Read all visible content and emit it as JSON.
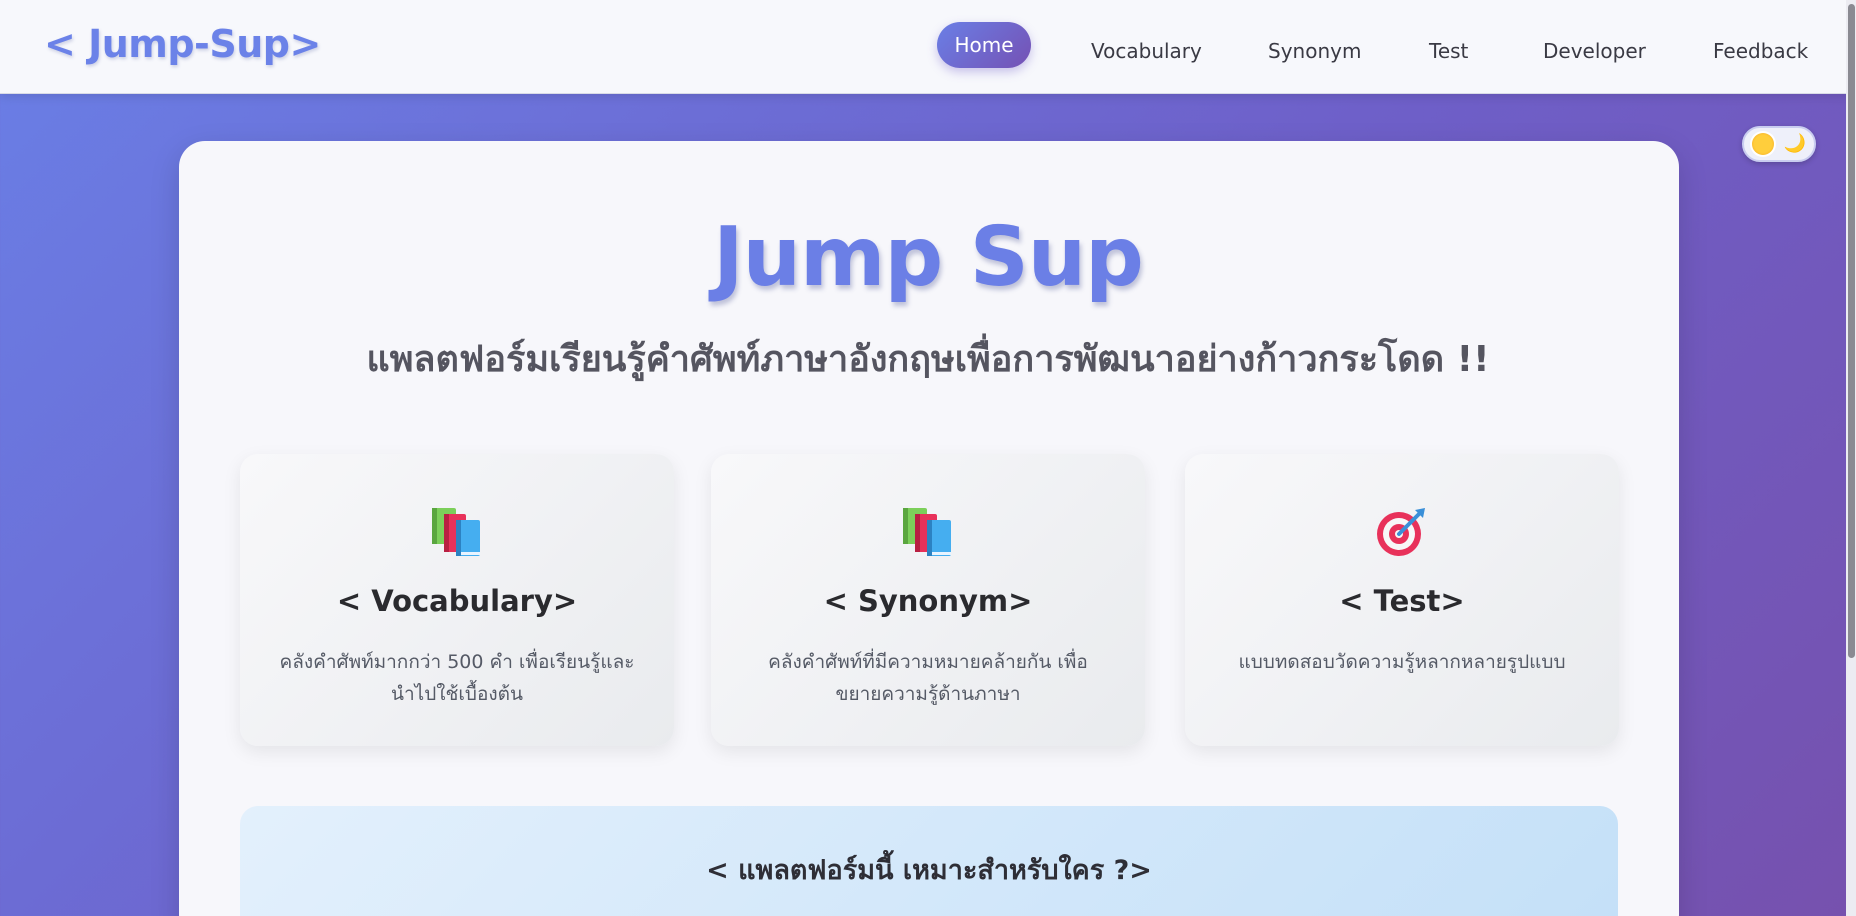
{
  "brand": "< Jump-Sup>",
  "nav": {
    "home": "Home",
    "vocabulary": "Vocabulary",
    "synonym": "Synonym",
    "test": "Test",
    "developer": "Developer",
    "feedback": "Feedback"
  },
  "theme_toggle": {
    "light_icon": "sun-icon",
    "dark_icon": "moon-icon",
    "moon_glyph": "🌙"
  },
  "hero": {
    "title": "Jump Sup",
    "subtitle": "แพลตฟอร์มเรียนรู้คำศัพท์ภาษาอังกฤษเพื่อการพัฒนาอย่างก้าวกระโดด !!"
  },
  "features": [
    {
      "icon": "books-icon",
      "title": "< Vocabulary>",
      "desc": "คลังคำศัพท์มากกว่า 500 คำ เพื่อเรียนรู้และนำไปใช้เบื้องต้น"
    },
    {
      "icon": "books-icon",
      "title": "< Synonym>",
      "desc": "คลังคำศัพท์ที่มีความหมายคล้ายกัน เพื่อขยายความรู้ด้านภาษา"
    },
    {
      "icon": "target-icon",
      "title": "< Test>",
      "desc": "แบบทดสอบวัดความรู้หลากหลายรูปแบบ"
    }
  ],
  "who": {
    "title": "< แพลตฟอร์มนี้ เหมาะสำหรับใคร ?>"
  },
  "colors": {
    "accent": "#6b7fe6",
    "gradient_start": "#6a7fe6",
    "gradient_end": "#7651ae"
  }
}
